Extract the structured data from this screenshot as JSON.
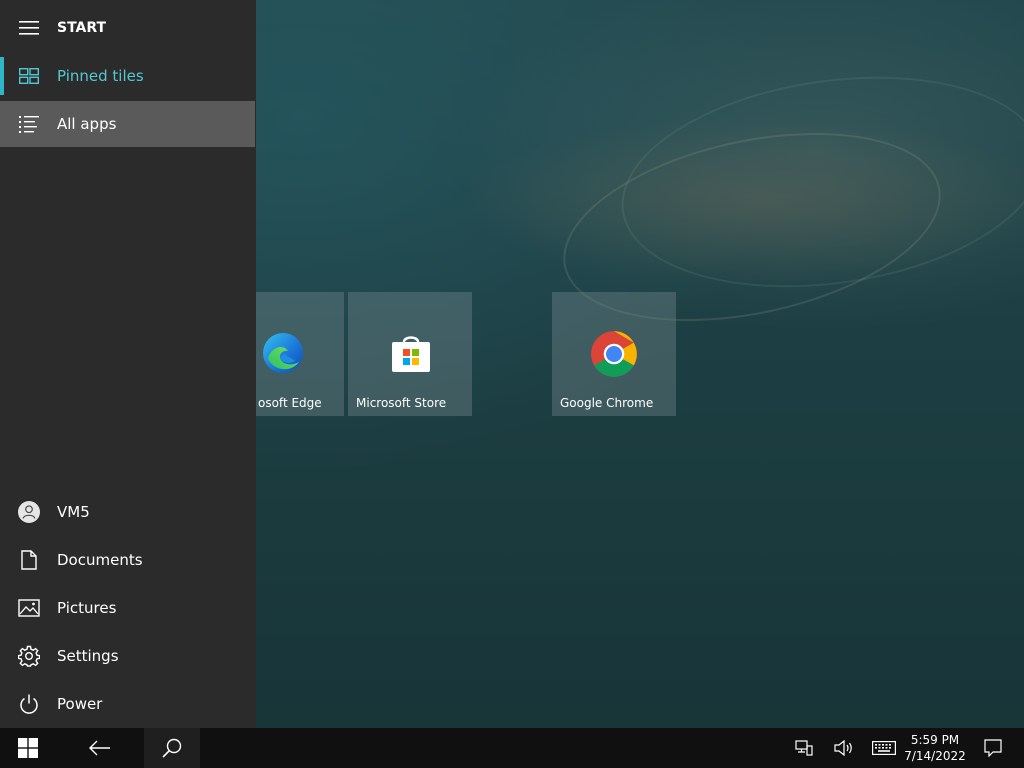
{
  "start_menu": {
    "header": "START",
    "pinned_tiles": "Pinned tiles",
    "all_apps": "All apps",
    "user": "VM5",
    "documents": "Documents",
    "pictures": "Pictures",
    "settings": "Settings",
    "power": "Power"
  },
  "tiles": {
    "edge": "osoft Edge",
    "store": "Microsoft Store",
    "chrome": "Google Chrome"
  },
  "taskbar": {
    "time": "5:59 PM",
    "date": "7/14/2022"
  },
  "colors": {
    "accent": "#31b6c9",
    "panel_bg": "#2b2b2b",
    "selected_bg": "#5a5a5a",
    "taskbar_bg": "#101010"
  }
}
